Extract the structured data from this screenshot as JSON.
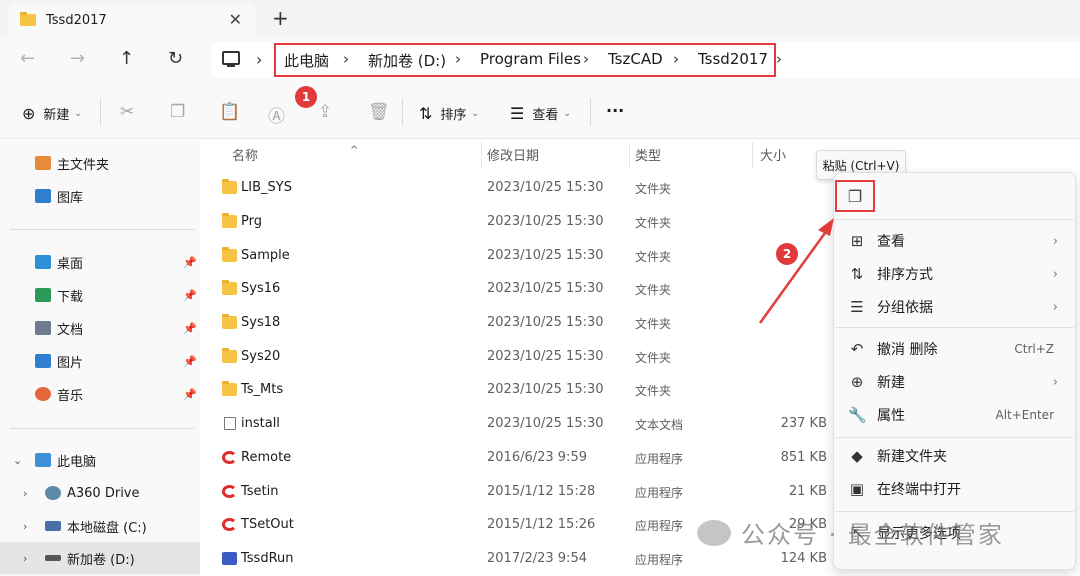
{
  "tab": {
    "title": "Tssd2017",
    "close": "✕",
    "new_tab": "+"
  },
  "nav": {
    "back": "←",
    "forward": "→",
    "up": "↑",
    "refresh": "↻"
  },
  "breadcrumb": [
    {
      "label": "此电脑"
    },
    {
      "label": "新加卷 (D:)"
    },
    {
      "label": "Program Files"
    },
    {
      "label": "TszCAD"
    },
    {
      "label": "Tssd2017"
    }
  ],
  "breadcrumb_separator": "›",
  "toolbar": {
    "new_label": "新建",
    "sort_label": "排序",
    "view_label": "查看",
    "more_label": "···",
    "badge_1": "1",
    "badge_2": "2"
  },
  "sidebar": {
    "home": "主文件夹",
    "gallery": "图库",
    "quick": [
      {
        "label": "桌面",
        "color": "#2d8fd6"
      },
      {
        "label": "下载",
        "color": "#2b9a58"
      },
      {
        "label": "文档",
        "color": "#6d7b8d"
      },
      {
        "label": "图片",
        "color": "#2f7fd0"
      },
      {
        "label": "音乐",
        "color": "#e4663a"
      }
    ],
    "this_pc": "此电脑",
    "drives": [
      {
        "label": "A360 Drive"
      },
      {
        "label": "本地磁盘 (C:)"
      },
      {
        "label": "新加卷 (D:)"
      }
    ]
  },
  "columns": {
    "name": "名称",
    "date": "修改日期",
    "type": "类型",
    "size": "大小"
  },
  "files": [
    {
      "name": "LIB_SYS",
      "date": "2023/10/25 15:30",
      "type": "文件夹",
      "size": "",
      "icon": "folder"
    },
    {
      "name": "Prg",
      "date": "2023/10/25 15:30",
      "type": "文件夹",
      "size": "",
      "icon": "folder"
    },
    {
      "name": "Sample",
      "date": "2023/10/25 15:30",
      "type": "文件夹",
      "size": "",
      "icon": "folder"
    },
    {
      "name": "Sys16",
      "date": "2023/10/25 15:30",
      "type": "文件夹",
      "size": "",
      "icon": "folder"
    },
    {
      "name": "Sys18",
      "date": "2023/10/25 15:30",
      "type": "文件夹",
      "size": "",
      "icon": "folder"
    },
    {
      "name": "Sys20",
      "date": "2023/10/25 15:30",
      "type": "文件夹",
      "size": "",
      "icon": "folder"
    },
    {
      "name": "Ts_Mts",
      "date": "2023/10/25 15:30",
      "type": "文件夹",
      "size": "",
      "icon": "folder"
    },
    {
      "name": "install",
      "date": "2023/10/25 15:30",
      "type": "文本文档",
      "size": "237 KB",
      "icon": "doc"
    },
    {
      "name": "Remote",
      "date": "2016/6/23 9:59",
      "type": "应用程序",
      "size": "851 KB",
      "icon": "app"
    },
    {
      "name": "Tsetin",
      "date": "2015/1/12 15:28",
      "type": "应用程序",
      "size": "21 KB",
      "icon": "app"
    },
    {
      "name": "TSetOut",
      "date": "2015/1/12 15:26",
      "type": "应用程序",
      "size": "29 KB",
      "icon": "app"
    },
    {
      "name": "TssdRun",
      "date": "2017/2/23 9:54",
      "type": "应用程序",
      "size": "124 KB",
      "icon": "run"
    }
  ],
  "tooltip": "粘贴 (Ctrl+V)",
  "context_menu": [
    {
      "label": "查看",
      "icon": "grid-icon",
      "glyph": "⊞",
      "shortcut": "",
      "arrow": "›"
    },
    {
      "label": "排序方式",
      "icon": "sort-icon",
      "glyph": "⇅",
      "shortcut": "",
      "arrow": "›"
    },
    {
      "label": "分组依据",
      "icon": "group-icon",
      "glyph": "☰",
      "shortcut": "",
      "arrow": "›"
    },
    {
      "label": "撤消 删除",
      "icon": "undo-icon",
      "glyph": "↶",
      "shortcut": "Ctrl+Z",
      "arrow": ""
    },
    {
      "label": "新建",
      "icon": "new-icon",
      "glyph": "⊕",
      "shortcut": "",
      "arrow": "›"
    },
    {
      "label": "属性",
      "icon": "wrench-icon",
      "glyph": "🔧",
      "shortcut": "Alt+Enter",
      "arrow": ""
    },
    {
      "label": "新建文件夹",
      "icon": "new-folder-icon",
      "glyph": "◆",
      "shortcut": "",
      "arrow": ""
    },
    {
      "label": "在终端中打开",
      "icon": "terminal-icon",
      "glyph": "▣",
      "shortcut": "",
      "arrow": ""
    },
    {
      "label": "显示更多选项",
      "icon": "more-options-icon",
      "glyph": "⇱",
      "shortcut": "",
      "arrow": ""
    }
  ],
  "watermark": "公众号 · 最全软件管家",
  "colors": {
    "accent_red": "#e43c3c",
    "folder": "#f6c343",
    "bg": "#f9f9f9"
  }
}
